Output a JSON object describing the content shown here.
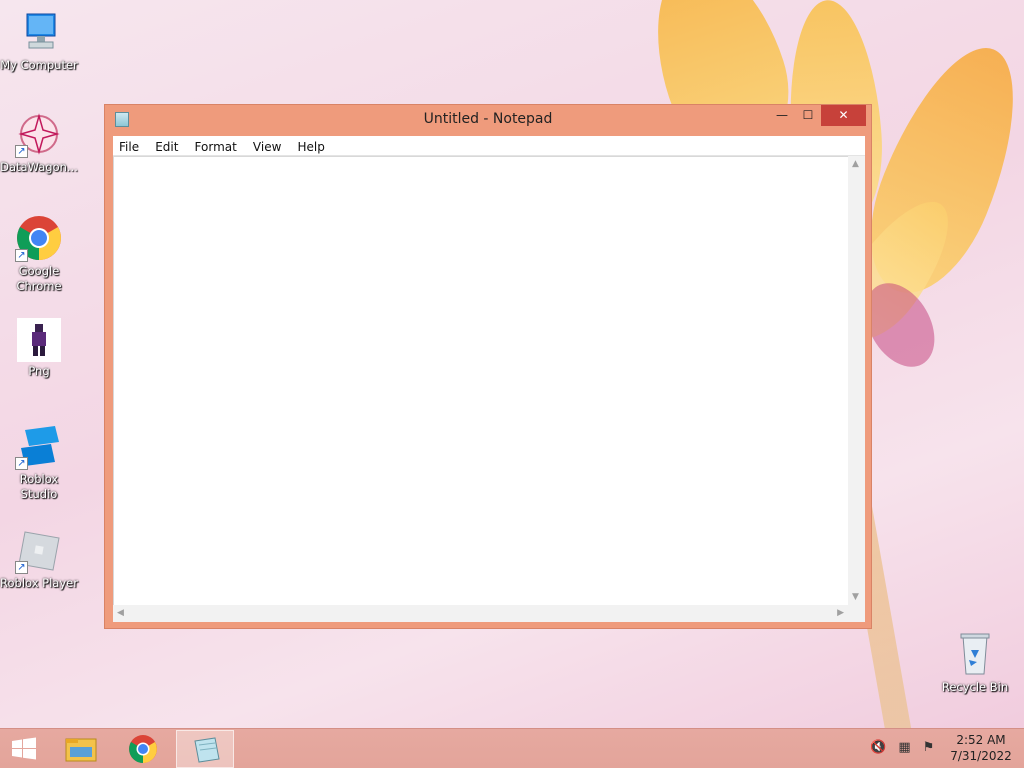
{
  "desktop": {
    "icons": [
      {
        "label": "My Computer"
      },
      {
        "label": "DataWagon..."
      },
      {
        "label": "Google Chrome"
      },
      {
        "label": "Png"
      },
      {
        "label": "Roblox Studio"
      },
      {
        "label": "Roblox Player"
      },
      {
        "label": "Recycle Bin"
      }
    ]
  },
  "notepad": {
    "title": "Untitled - Notepad",
    "menu": [
      "File",
      "Edit",
      "Format",
      "View",
      "Help"
    ],
    "controls": {
      "minimize": "—",
      "maximize": "☐",
      "close": "✕"
    },
    "content": ""
  },
  "taskbar": {
    "clock_time": "2:52 AM",
    "clock_date": "7/31/2022",
    "pinned": [
      "start-icon",
      "file-explorer-icon",
      "chrome-icon",
      "notepad-icon"
    ]
  },
  "colors": {
    "window_frame": "#ef9b7c",
    "close_button": "#c7413a",
    "taskbar": "#e3a49a"
  }
}
